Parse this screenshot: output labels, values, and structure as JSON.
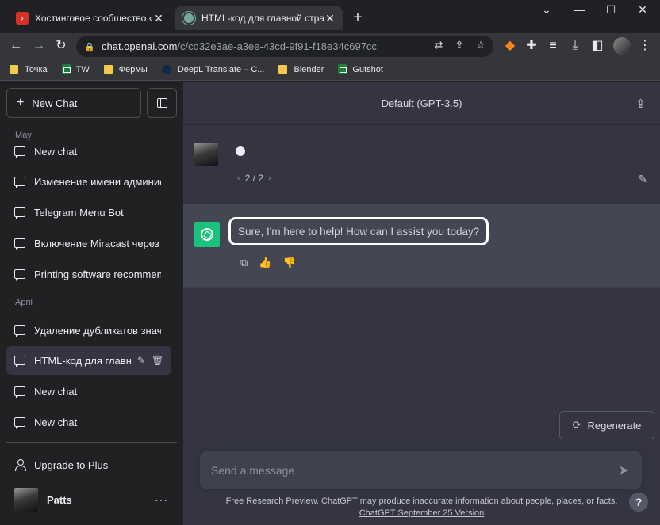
{
  "browser": {
    "tabs": [
      {
        "title": "Хостинговое сообщество «Tim",
        "active": false
      },
      {
        "title": "HTML-код для главной страниц",
        "active": true
      }
    ],
    "url_host": "chat.openai.com",
    "url_path": "/c/cd32e3ae-a3ee-43cd-9f91-f18e34c697cc",
    "bookmarks": [
      {
        "label": "Точка",
        "icon": "folder-icon"
      },
      {
        "label": "TW",
        "icon": "google-sheets-icon"
      },
      {
        "label": "Фермы",
        "icon": "folder-icon"
      },
      {
        "label": "DeepL Translate – C...",
        "icon": "deepl-icon"
      },
      {
        "label": "Blender",
        "icon": "folder-icon"
      },
      {
        "label": "Gutshot",
        "icon": "google-sheets-icon"
      }
    ]
  },
  "sidebar": {
    "new_chat_label": "New Chat",
    "sections": [
      {
        "label": "May",
        "items": [
          "New chat",
          "Изменение имени администратора",
          "Telegram Menu Bot",
          "Включение Miracast через реестр",
          "Printing software recommendations"
        ]
      },
      {
        "label": "April",
        "items": [
          "Удаление дубликатов значений",
          "HTML-код для главной страницы",
          "New chat",
          "New chat"
        ]
      }
    ],
    "active_item": "HTML-код для главной страницы",
    "upgrade_label": "Upgrade to Plus",
    "user_name": "Patts"
  },
  "main": {
    "model_label": "Default (GPT-3.5)",
    "user_message": {
      "pager": "2 / 2"
    },
    "assistant_message": "Sure, I'm here to help! How can I assist you today?",
    "regenerate_label": "Regenerate",
    "composer_placeholder": "Send a message",
    "disclaimer": "Free Research Preview. ChatGPT may produce inaccurate information about people, places, or facts.",
    "version_link": "ChatGPT September 25 Version",
    "help_label": "?"
  },
  "colors": {
    "sidebar_bg": "#202123",
    "main_bg": "#343541",
    "assistant_bg": "#444654",
    "gpt_green": "#19c37d"
  }
}
